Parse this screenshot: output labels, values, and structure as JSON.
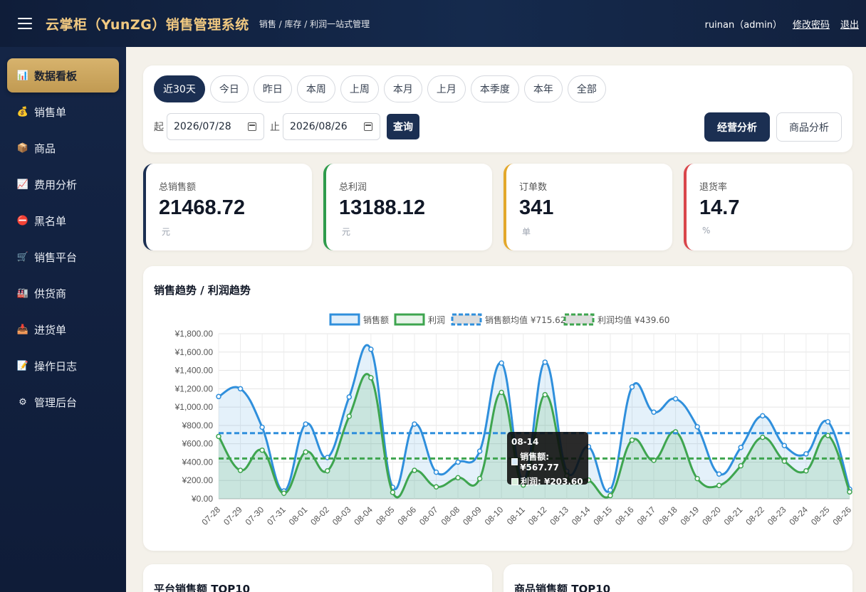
{
  "header": {
    "title": "云掌柜（YunZG）销售管理系统",
    "subtitle": "销售 / 库存 / 利润一站式管理",
    "user": "ruinan（admin）",
    "change_password": "修改密码",
    "logout": "退出"
  },
  "sidebar": {
    "items": [
      {
        "label": "数据看板",
        "icon": "bar-chart-icon",
        "glyph": "📊",
        "active": true
      },
      {
        "label": "销售单",
        "icon": "money-bag-icon",
        "glyph": "💰"
      },
      {
        "label": "商品",
        "icon": "package-icon",
        "glyph": "📦"
      },
      {
        "label": "费用分析",
        "icon": "line-chart-icon",
        "glyph": "📈"
      },
      {
        "label": "黑名单",
        "icon": "no-entry-icon",
        "glyph": "⛔"
      },
      {
        "label": "销售平台",
        "icon": "cart-icon",
        "glyph": "🛒"
      },
      {
        "label": "供货商",
        "icon": "factory-icon",
        "glyph": "🏭"
      },
      {
        "label": "进货单",
        "icon": "inbox-icon",
        "glyph": "📥"
      },
      {
        "label": "操作日志",
        "icon": "memo-icon",
        "glyph": "📝"
      },
      {
        "label": "管理后台",
        "icon": "gear-icon",
        "glyph": "⚙"
      }
    ]
  },
  "filter": {
    "ranges": [
      "近30天",
      "今日",
      "昨日",
      "本周",
      "上周",
      "本月",
      "上月",
      "本季度",
      "本年",
      "全部"
    ],
    "active_range": "近30天",
    "start_label": "起",
    "start_date": "2026/07/28",
    "end_label": "止",
    "end_date": "2026/08/26",
    "query_label": "查询",
    "business_analysis": "经营分析",
    "product_analysis": "商品分析"
  },
  "kpis": [
    {
      "label": "总销售额",
      "value": "21468.72",
      "unit": "元",
      "color": "#1b2f52"
    },
    {
      "label": "总利润",
      "value": "13188.12",
      "unit": "元",
      "color": "#2e9b4b"
    },
    {
      "label": "订单数",
      "value": "341",
      "unit": "单",
      "color": "#e3a82b"
    },
    {
      "label": "退货率",
      "value": "14.7",
      "unit": "%",
      "color": "#d9464b"
    }
  ],
  "chart": {
    "title": "销售趋势 / 利润趋势",
    "tooltip": {
      "date": "08-14",
      "sales": "销售额: ¥567.77",
      "profit": "利润: ¥203.60"
    }
  },
  "chart_data": {
    "type": "line",
    "x": [
      "07-28",
      "07-29",
      "07-30",
      "07-31",
      "08-01",
      "08-02",
      "08-03",
      "08-04",
      "08-05",
      "08-06",
      "08-07",
      "08-08",
      "08-09",
      "08-10",
      "08-11",
      "08-12",
      "08-13",
      "08-14",
      "08-15",
      "08-16",
      "08-17",
      "08-18",
      "08-19",
      "08-20",
      "08-21",
      "08-22",
      "08-23",
      "08-24",
      "08-25",
      "08-26"
    ],
    "series": [
      {
        "name": "销售额",
        "color": "#2f8fdc",
        "values": [
          1115,
          1200,
          780,
          85,
          815,
          450,
          1110,
          1630,
          125,
          815,
          290,
          400,
          520,
          1480,
          200,
          1490,
          300,
          567.77,
          95,
          1220,
          945,
          1090,
          785,
          270,
          560,
          905,
          580,
          490,
          840,
          105
        ]
      },
      {
        "name": "利润",
        "color": "#3ea54f",
        "values": [
          680,
          310,
          530,
          60,
          510,
          305,
          900,
          1320,
          70,
          310,
          130,
          230,
          220,
          1160,
          150,
          1135,
          250,
          203.6,
          35,
          640,
          420,
          730,
          220,
          145,
          360,
          670,
          410,
          305,
          690,
          75
        ]
      }
    ],
    "averages": [
      {
        "name": "销售额均值 ¥715.62",
        "value": 715.62,
        "color": "#2f8fdc"
      },
      {
        "name": "利润均值 ¥439.60",
        "value": 439.6,
        "color": "#3ea54f"
      }
    ],
    "yticks": [
      "¥1,800.00",
      "¥1,600.00",
      "¥1,400.00",
      "¥1,200.00",
      "¥1,000.00",
      "¥800.00",
      "¥600.00",
      "¥400.00",
      "¥200.00",
      "¥0.00"
    ],
    "ylim": [
      0,
      1800
    ],
    "grid": true,
    "legend": "top"
  },
  "bottom": {
    "platform_top10": "平台销售额 TOP10",
    "product_top10": "商品销售额 TOP10"
  }
}
